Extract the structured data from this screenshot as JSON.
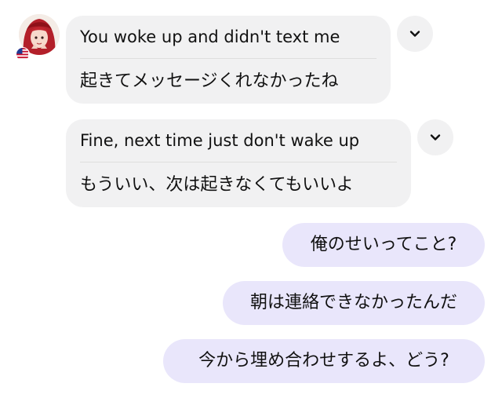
{
  "conversation": {
    "incoming": [
      {
        "original": "You woke up and didn't text me",
        "translation": "起きてメッセージくれなかったね"
      },
      {
        "original": "Fine, next time just don't wake up",
        "translation": "もういい、次は起きなくてもいいよ"
      }
    ],
    "outgoing": [
      "俺のせいってこと?",
      "朝は連絡できなかったんだ",
      "今から埋め合わせするよ、どう?"
    ]
  },
  "icons": {
    "avatar": "avatar-image",
    "flag": "us-flag-icon",
    "expand": "chevron-down-icon"
  },
  "colors": {
    "incoming_bubble": "#f1f1f2",
    "outgoing_bubble": "#e9e6fb",
    "divider": "#dedede",
    "text": "#111111"
  }
}
